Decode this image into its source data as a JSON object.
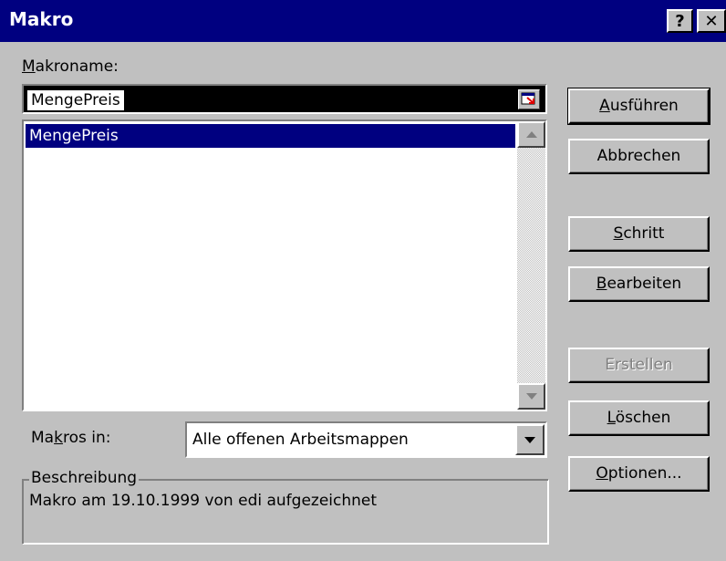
{
  "window": {
    "title": "Makro",
    "help_button": "?",
    "close_button": "✕"
  },
  "makroname": {
    "label_accel": "M",
    "label_rest": "akroname:",
    "value": "MengePreis"
  },
  "macro_list": {
    "items": [
      "MengePreis"
    ]
  },
  "buttons": {
    "ausfuehren": {
      "accel": "A",
      "rest": "usführen"
    },
    "abbrechen": {
      "label": "Abbrechen"
    },
    "schritt": {
      "accel": "S",
      "rest": "chritt"
    },
    "bearbeiten": {
      "accel": "B",
      "rest": "earbeiten"
    },
    "erstellen": {
      "label": "Erstellen"
    },
    "loeschen": {
      "accel": "L",
      "rest": "öschen"
    },
    "optionen": {
      "accel": "O",
      "rest": "ptionen..."
    }
  },
  "makros_in": {
    "label_pre": "Ma",
    "label_accel": "k",
    "label_post": "ros in:",
    "value": "Alle offenen Arbeitsmappen"
  },
  "beschreibung": {
    "legend": "Beschreibung",
    "text": "Makro am 19.10.1999 von edi aufgezeichnet"
  },
  "colors": {
    "title_bar": "#000080",
    "face": "#c0c0c0",
    "selection": "#000080",
    "disabled_text": "#808080"
  }
}
